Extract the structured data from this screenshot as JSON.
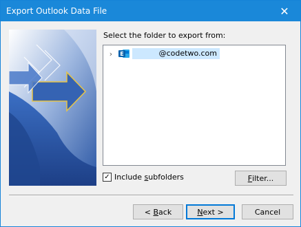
{
  "window": {
    "title": "Export Outlook Data File",
    "close_glyph": "✕"
  },
  "prompt": "Select the folder to export from:",
  "tree": {
    "items": [
      {
        "label": "@codetwo.com",
        "icon": "exchange-icon",
        "expander": "›",
        "selected": true
      }
    ]
  },
  "include_subfolders": {
    "label_before": "Include ",
    "label_mnemonic": "s",
    "label_after": "ubfolders",
    "checked": true
  },
  "buttons": {
    "filter": {
      "mnemonic": "F",
      "rest": "ilter..."
    },
    "back": {
      "before": "< ",
      "mnemonic": "B",
      "rest": "ack"
    },
    "next": {
      "mnemonic": "N",
      "rest": "ext >"
    },
    "cancel": "Cancel"
  },
  "colors": {
    "titlebar": "#1a88d9",
    "selection": "#cce8ff",
    "accent": "#0078d7"
  }
}
